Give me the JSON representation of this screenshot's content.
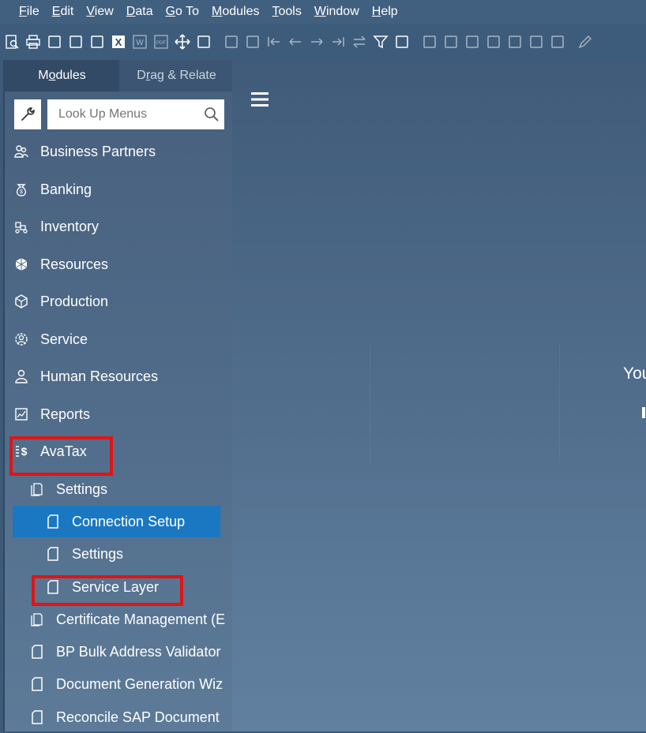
{
  "menubar": {
    "items": [
      {
        "label": "File",
        "accel": "F",
        "rest": "ile"
      },
      {
        "label": "Edit",
        "accel": "E",
        "rest": "dit"
      },
      {
        "label": "View",
        "accel": "V",
        "rest": "iew"
      },
      {
        "label": "Data",
        "accel": "D",
        "rest": "ata"
      },
      {
        "label": "Go To",
        "accel": "G",
        "rest": "o To"
      },
      {
        "label": "Modules",
        "accel": "M",
        "rest": "odules"
      },
      {
        "label": "Tools",
        "accel": "T",
        "rest": "ools"
      },
      {
        "label": "Window",
        "accel": "W",
        "rest": "indow"
      },
      {
        "label": "Help",
        "accel": "H",
        "rest": "elp"
      }
    ]
  },
  "toolbar": {
    "icons": [
      "preview-icon",
      "print-icon",
      "print-preview-icon",
      "send-message-icon",
      "export-icon",
      "excel-icon",
      "word-icon",
      "pdf-icon",
      "move-icon",
      "form-settings-icon",
      "pick-icon",
      "lock-icon",
      "first-record-icon",
      "previous-record-icon",
      "next-record-icon",
      "last-record-icon",
      "swap-icon",
      "filter-icon",
      "sort-icon",
      "base-document-icon",
      "target-document-icon",
      "gross-profit-icon",
      "payment-means-icon",
      "balance-icon",
      "volume-icon",
      "transaction-journal-icon",
      "edit-icon"
    ]
  },
  "sidebar": {
    "tabs": {
      "modules": {
        "pre": "M",
        "accel": "o",
        "post": "dules"
      },
      "drag_relate": {
        "pre": "D",
        "accel": "r",
        "post": "ag & Relate"
      }
    },
    "search": {
      "placeholder": "Look Up Menus"
    },
    "items": [
      {
        "label": "Business Partners",
        "icon": "business-partners-icon"
      },
      {
        "label": "Banking",
        "icon": "banking-icon"
      },
      {
        "label": "Inventory",
        "icon": "inventory-icon"
      },
      {
        "label": "Resources",
        "icon": "resources-icon"
      },
      {
        "label": "Production",
        "icon": "production-icon"
      },
      {
        "label": "Service",
        "icon": "service-icon"
      },
      {
        "label": "Human Resources",
        "icon": "human-resources-icon"
      },
      {
        "label": "Reports",
        "icon": "reports-icon"
      },
      {
        "label": "AvaTax",
        "icon": "avatax-icon"
      }
    ],
    "avatax_children": {
      "settings_folder": "Settings",
      "connection_setup": "Connection Setup",
      "settings": "Settings",
      "service_layer": "Service Layer",
      "certificate_management": "Certificate Management (E",
      "bp_bulk": "BP Bulk Address Validator",
      "document_generation": "Document Generation Wiz",
      "reconcile": "Reconcile SAP Document"
    }
  },
  "main": {
    "partial_text": "You"
  },
  "colors": {
    "selected_bg": "#1a78c2",
    "highlight_border": "#e01414"
  }
}
